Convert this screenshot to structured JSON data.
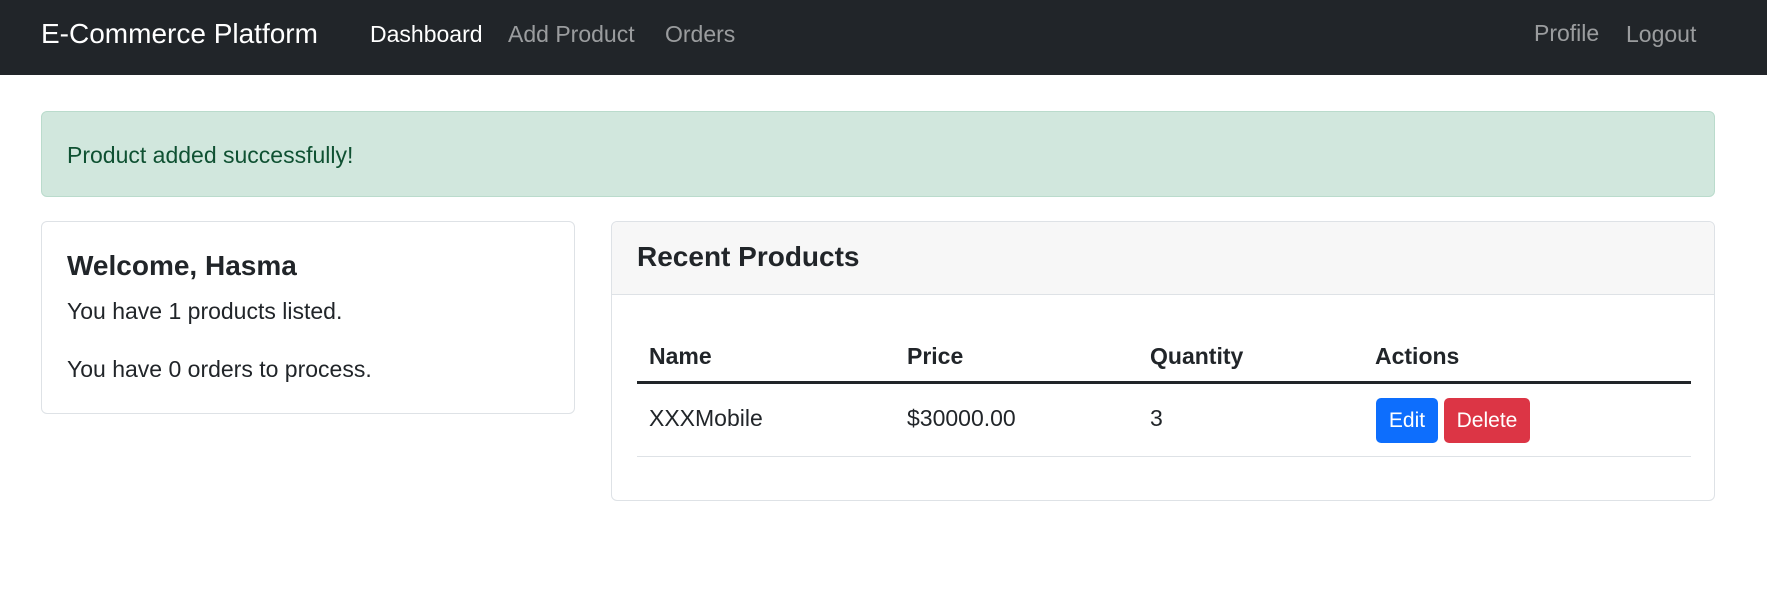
{
  "navbar": {
    "brand": "E-Commerce Platform",
    "links": [
      {
        "label": "Dashboard",
        "active": true
      },
      {
        "label": "Add Product",
        "active": false
      },
      {
        "label": "Orders",
        "active": false
      }
    ],
    "right_links": [
      {
        "label": "Profile"
      },
      {
        "label": "Logout"
      }
    ]
  },
  "alert": {
    "message": "Product added successfully!",
    "color": "#d1e7dd"
  },
  "welcome": {
    "title": "Welcome, Hasma",
    "products_line": "You have 1 products listed.",
    "orders_line": "You have 0 orders to process."
  },
  "recent_products": {
    "title": "Recent Products",
    "columns": [
      "Name",
      "Price",
      "Quantity",
      "Actions"
    ],
    "rows": [
      {
        "name": "XXXMobile",
        "price": "$30000.00",
        "quantity": "3",
        "edit_label": "Edit",
        "delete_label": "Delete"
      }
    ]
  },
  "colors": {
    "navbar_bg": "#212529",
    "edit_button": "#0d6efd",
    "delete_button": "#dc3545"
  }
}
